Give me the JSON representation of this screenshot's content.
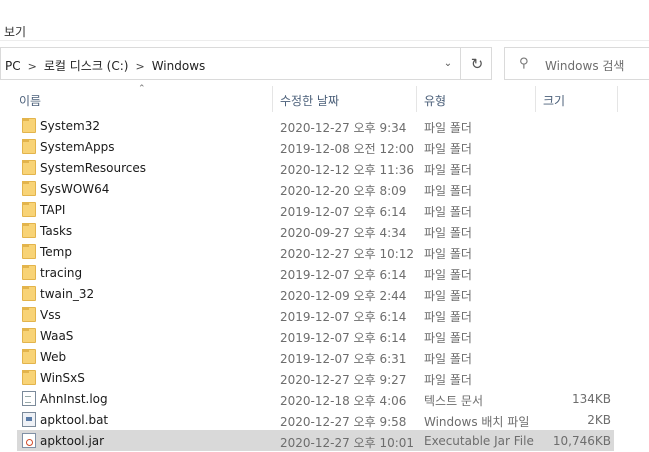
{
  "menu": {
    "view_label": "보기"
  },
  "breadcrumb": {
    "items": [
      "PC",
      "로컬 디스크 (C:)",
      "Windows"
    ]
  },
  "search": {
    "placeholder": "Windows 검색"
  },
  "columns": {
    "name": "이름",
    "date": "수정한 날짜",
    "type": "유형",
    "size": "크기"
  },
  "files": [
    {
      "name": "System32",
      "date": "2020-12-27 오후 9:34",
      "type": "파일 폴더",
      "size": "",
      "icon": "folder-icon"
    },
    {
      "name": "SystemApps",
      "date": "2019-12-08 오전 12:00",
      "type": "파일 폴더",
      "size": "",
      "icon": "folder-icon"
    },
    {
      "name": "SystemResources",
      "date": "2020-12-12 오후 11:36",
      "type": "파일 폴더",
      "size": "",
      "icon": "folder-icon"
    },
    {
      "name": "SysWOW64",
      "date": "2020-12-20 오후 8:09",
      "type": "파일 폴더",
      "size": "",
      "icon": "folder-icon"
    },
    {
      "name": "TAPI",
      "date": "2019-12-07 오후 6:14",
      "type": "파일 폴더",
      "size": "",
      "icon": "folder-icon"
    },
    {
      "name": "Tasks",
      "date": "2020-09-27 오후 4:34",
      "type": "파일 폴더",
      "size": "",
      "icon": "folder-icon"
    },
    {
      "name": "Temp",
      "date": "2020-12-27 오후 10:12",
      "type": "파일 폴더",
      "size": "",
      "icon": "folder-icon"
    },
    {
      "name": "tracing",
      "date": "2019-12-07 오후 6:14",
      "type": "파일 폴더",
      "size": "",
      "icon": "folder-icon"
    },
    {
      "name": "twain_32",
      "date": "2020-12-09 오후 2:44",
      "type": "파일 폴더",
      "size": "",
      "icon": "folder-icon"
    },
    {
      "name": "Vss",
      "date": "2019-12-07 오후 6:14",
      "type": "파일 폴더",
      "size": "",
      "icon": "folder-icon"
    },
    {
      "name": "WaaS",
      "date": "2019-12-07 오후 6:14",
      "type": "파일 폴더",
      "size": "",
      "icon": "folder-icon"
    },
    {
      "name": "Web",
      "date": "2019-12-07 오후 6:31",
      "type": "파일 폴더",
      "size": "",
      "icon": "folder-icon"
    },
    {
      "name": "WinSxS",
      "date": "2020-12-27 오후 9:27",
      "type": "파일 폴더",
      "size": "",
      "icon": "folder-icon"
    },
    {
      "name": "AhnInst.log",
      "date": "2020-12-18 오후 4:06",
      "type": "텍스트 문서",
      "size": "134KB",
      "icon": "text-file-icon"
    },
    {
      "name": "apktool.bat",
      "date": "2020-12-27 오후 9:58",
      "type": "Windows 배치 파일",
      "size": "2KB",
      "icon": "batch-file-icon"
    },
    {
      "name": "apktool.jar",
      "date": "2020-12-27 오후 10:01",
      "type": "Executable Jar File",
      "size": "10,746KB",
      "icon": "jar-file-icon",
      "selected": true
    }
  ]
}
